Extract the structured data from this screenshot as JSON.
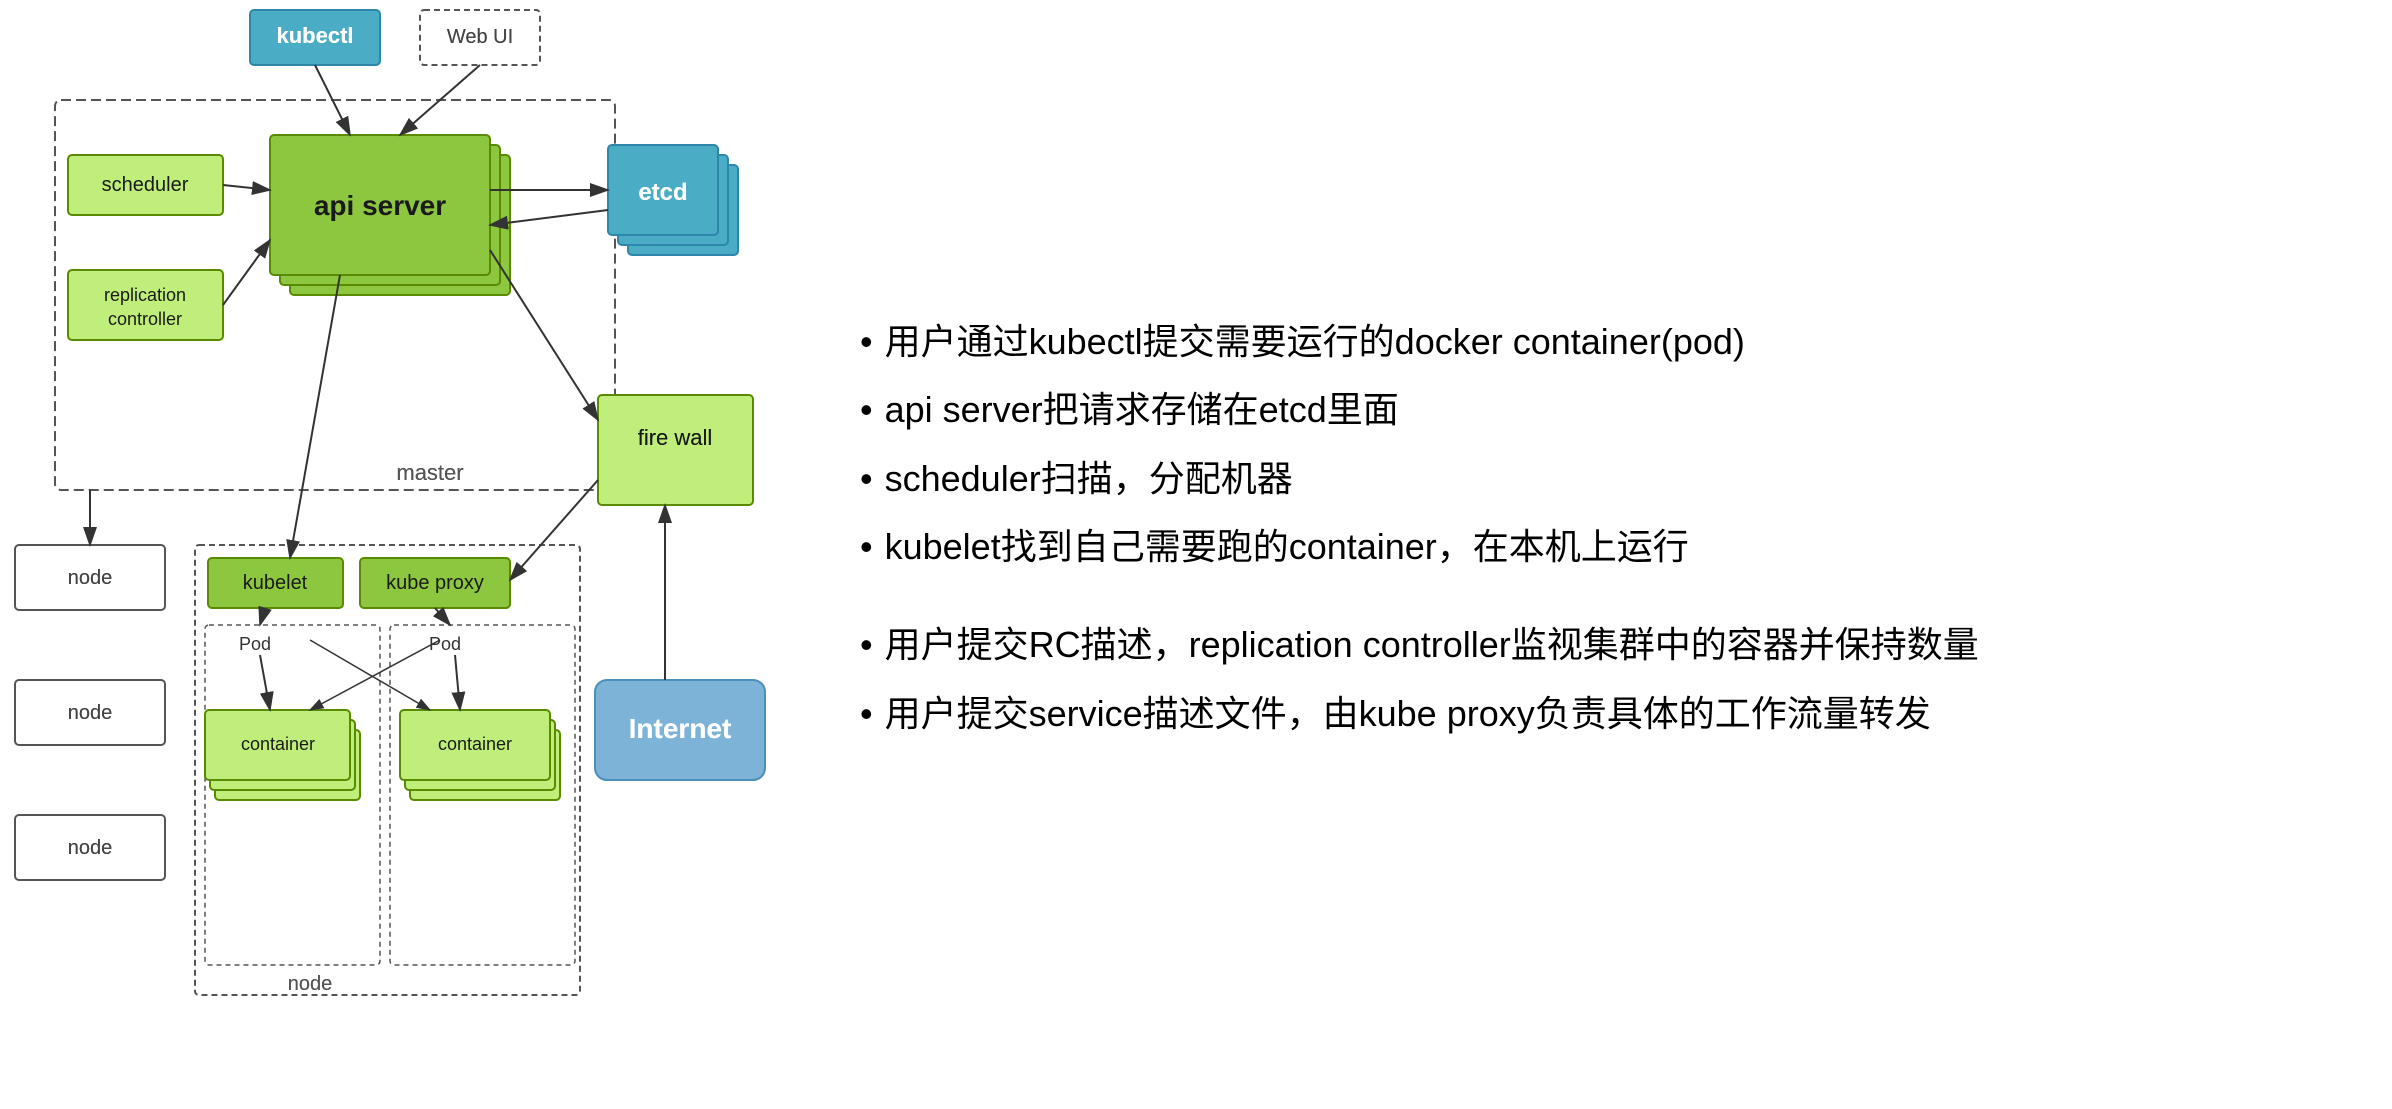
{
  "diagram": {
    "kubectl_label": "kubectl",
    "webui_label": "Web UI",
    "api_server_label": "api server",
    "scheduler_label": "scheduler",
    "replication_controller_label": "replication\ncontroller",
    "master_label": "master",
    "etcd_label": "etcd",
    "firewall_label": "fire wall",
    "internet_label": "Internet",
    "kubelet_label": "kubelet",
    "kube_proxy_label": "kube proxy",
    "pod_label1": "Pod",
    "pod_label2": "Pod",
    "container_label1": "container",
    "container_label2": "container",
    "node_label1": "node",
    "node_label2": "node",
    "node_label3": "node",
    "node_bottom_label": "node"
  },
  "bullets": [
    {
      "text": "用户通过kubectl提交需要运行的docker container(pod)"
    },
    {
      "text": "api server把请求存储在etcd里面"
    },
    {
      "text": "scheduler扫描，分配机器"
    },
    {
      "text": "kubelet找到自己需要跑的container，在本机上运行"
    },
    {
      "text": "用户提交RC描述，replication controller监视集群中的容器并保持数量"
    },
    {
      "text": "用户提交service描述文件，由kube proxy负责具体的工作流量转发"
    }
  ]
}
